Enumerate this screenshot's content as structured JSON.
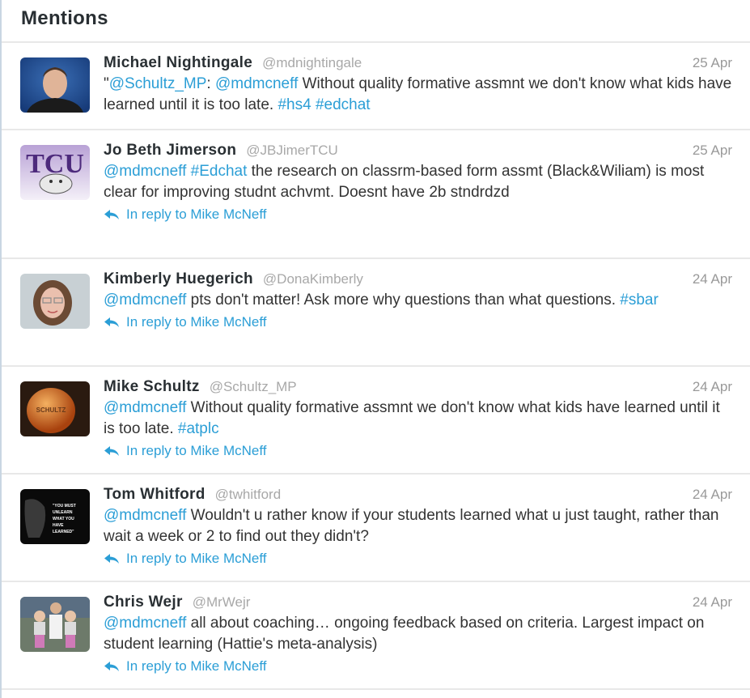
{
  "header": {
    "title": "Mentions"
  },
  "colors": {
    "link": "#2b9ed6",
    "text": "#333333",
    "muted": "#a8a8a8",
    "divider": "#e8e8e8"
  },
  "tweets": [
    {
      "name": "Michael Nightingale",
      "handle": "@mdnightingale",
      "date": "25 Apr",
      "avatar_icon": "avatar-photo-man",
      "segments": [
        {
          "t": "\"",
          "link": false
        },
        {
          "t": "@Schultz_MP",
          "link": true
        },
        {
          "t": ": ",
          "link": false
        },
        {
          "t": "@mdmcneff",
          "link": true
        },
        {
          "t": " Without quality formative assmnt we don't know what kids have learned until it is too late. ",
          "link": false
        },
        {
          "t": "#hs4",
          "link": true
        },
        {
          "t": " ",
          "link": false
        },
        {
          "t": "#edchat",
          "link": true
        }
      ],
      "reply": null
    },
    {
      "name": "Jo Beth Jimerson",
      "handle": "@JBJimerTCU",
      "date": "25 Apr",
      "avatar_icon": "avatar-tcu-logo",
      "segments": [
        {
          "t": "@mdmcneff",
          "link": true
        },
        {
          "t": " ",
          "link": false
        },
        {
          "t": "#Edchat",
          "link": true
        },
        {
          "t": " the research on classrm-based form assmt (Black&Wiliam) is most clear for improving studnt achvmt. Doesnt have 2b stndrdzd",
          "link": false
        }
      ],
      "reply": "In reply to Mike McNeff"
    },
    {
      "name": "Kimberly Huegerich",
      "handle": "@DonaKimberly",
      "date": "24 Apr",
      "avatar_icon": "avatar-photo-woman",
      "segments": [
        {
          "t": "@mdmcneff",
          "link": true
        },
        {
          "t": " pts don't matter! Ask more why questions than what questions. ",
          "link": false
        },
        {
          "t": "#sbar",
          "link": true
        }
      ],
      "reply": "In reply to Mike McNeff"
    },
    {
      "name": "Mike Schultz",
      "handle": "@Schultz_MP",
      "date": "24 Apr",
      "avatar_icon": "avatar-orange-ball",
      "segments": [
        {
          "t": "@mdmcneff",
          "link": true
        },
        {
          "t": " Without quality formative assmnt we don't know what kids have learned until it is too late. ",
          "link": false
        },
        {
          "t": "#atplc",
          "link": true
        }
      ],
      "reply": "In reply to Mike McNeff"
    },
    {
      "name": "Tom Whitford",
      "handle": "@twhitford",
      "date": "24 Apr",
      "avatar_icon": "avatar-quote-poster",
      "segments": [
        {
          "t": "@mdmcneff",
          "link": true
        },
        {
          "t": " Wouldn't u rather know if your students learned what u just taught, rather than wait a week or 2 to find out they didn't?",
          "link": false
        }
      ],
      "reply": "In reply to Mike McNeff"
    },
    {
      "name": "Chris Wejr",
      "handle": "@MrWejr",
      "date": "24 Apr",
      "avatar_icon": "avatar-photo-family",
      "segments": [
        {
          "t": "@mdmcneff",
          "link": true
        },
        {
          "t": " all about coaching… ongoing feedback based on criteria. Largest impact on student learning (Hattie's meta-analysis)",
          "link": false
        }
      ],
      "reply": "In reply to Mike McNeff"
    }
  ]
}
